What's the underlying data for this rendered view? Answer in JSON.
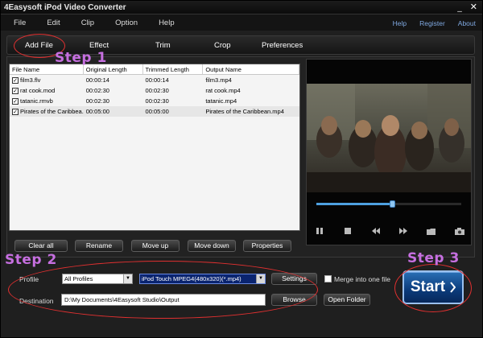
{
  "window": {
    "title": "4Easysoft iPod Video Converter",
    "minimize": "_",
    "close": "✕"
  },
  "menu": {
    "items": [
      "File",
      "Edit",
      "Clip",
      "Option",
      "Help"
    ],
    "links": [
      "Help",
      "Register",
      "About"
    ]
  },
  "toolbar": {
    "items": [
      "Add File",
      "Effect",
      "Trim",
      "Crop",
      "Preferences"
    ]
  },
  "file_table": {
    "headers": [
      "File Name",
      "Original Length",
      "Trimmed Length",
      "Output Name"
    ],
    "rows": [
      {
        "name": "film3.flv",
        "original": "00:00:14",
        "trimmed": "00:00:14",
        "output": "film3.mp4",
        "checked": true
      },
      {
        "name": "rat cook.mod",
        "original": "00:02:30",
        "trimmed": "00:02:30",
        "output": "rat cook.mp4",
        "checked": true
      },
      {
        "name": "tatanic.rmvb",
        "original": "00:02:30",
        "trimmed": "00:02:30",
        "output": "tatanic.mp4",
        "checked": true
      },
      {
        "name": "Pirates of the Caribbea...",
        "original": "00:05:00",
        "trimmed": "00:05:00",
        "output": "Pirates of the Caribbean.mp4",
        "checked": true
      }
    ]
  },
  "list_buttons": [
    "Clear all",
    "Rename",
    "Move up",
    "Move down",
    "Properties"
  ],
  "player": {
    "seek_fraction": 0.52,
    "controls": [
      "pause-icon",
      "stop-icon",
      "rewind-icon",
      "forward-icon",
      "folder-icon",
      "camera-icon"
    ]
  },
  "output": {
    "profile_label": "Profile",
    "profile_category": "All Profiles",
    "profile_format": "iPod Touch MPEG4(480x320)(*.mp4)",
    "settings_label": "Settings",
    "merge_label": "Merge into one file",
    "destination_label": "Destination",
    "destination_path": "D:\\My Documents\\4Easysoft Studio\\Output",
    "browse_label": "Browse",
    "open_folder_label": "Open Folder",
    "start_label": "Start"
  },
  "annotations": {
    "step1": "Step 1",
    "step2": "Step 2",
    "step3": "Step 3",
    "color": "#c66fe0",
    "ellipse_color": "#e03030"
  },
  "colors": {
    "accent": "#4da0e0",
    "start_button": "#0b3a7a"
  }
}
